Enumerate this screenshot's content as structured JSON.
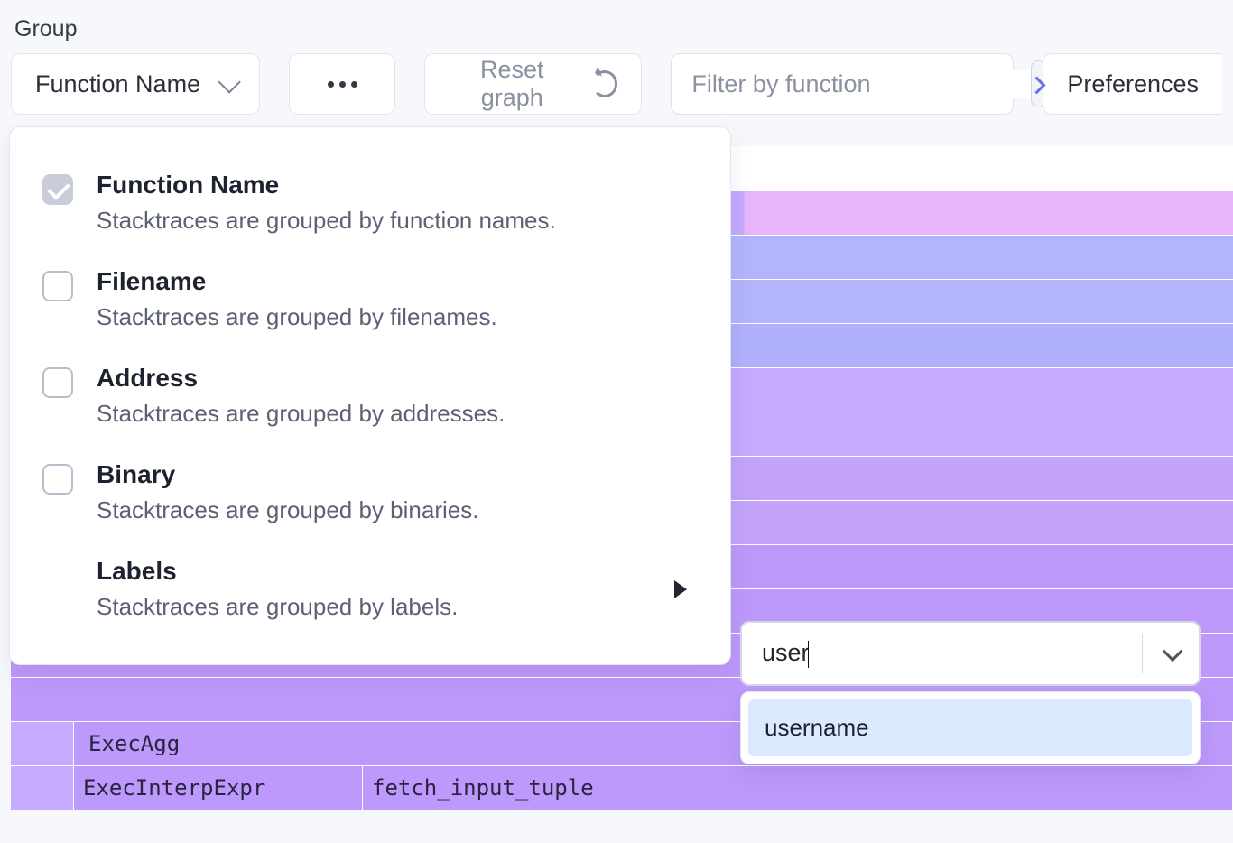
{
  "group_label": "Group",
  "toolbar": {
    "group_dropdown_label": "Function Name",
    "reset_label": "Reset graph",
    "filter_placeholder": "Filter by function",
    "preferences_label": "Preferences"
  },
  "group_options": [
    {
      "title": "Function Name",
      "desc": "Stacktraces are grouped by function names.",
      "checked": true,
      "has_checkbox": true,
      "submenu": false
    },
    {
      "title": "Filename",
      "desc": "Stacktraces are grouped by filenames.",
      "checked": false,
      "has_checkbox": true,
      "submenu": false
    },
    {
      "title": "Address",
      "desc": "Stacktraces are grouped by addresses.",
      "checked": false,
      "has_checkbox": true,
      "submenu": false
    },
    {
      "title": "Binary",
      "desc": "Stacktraces are grouped by binaries.",
      "checked": false,
      "has_checkbox": true,
      "submenu": false
    },
    {
      "title": "Labels",
      "desc": "Stacktraces are grouped by labels.",
      "checked": false,
      "has_checkbox": false,
      "submenu": true
    }
  ],
  "labels_combo": {
    "input_value": "user",
    "suggestion": "username"
  },
  "flame": {
    "bottom_row_a": "ExecAgg",
    "bottom_row_b_left": "ExecInterpExpr",
    "bottom_row_b_right": "fetch_input_tuple"
  },
  "colors": {
    "accent": "#6a6fe2",
    "panel_border": "#e3e6ef",
    "text_muted": "#5c6274"
  }
}
